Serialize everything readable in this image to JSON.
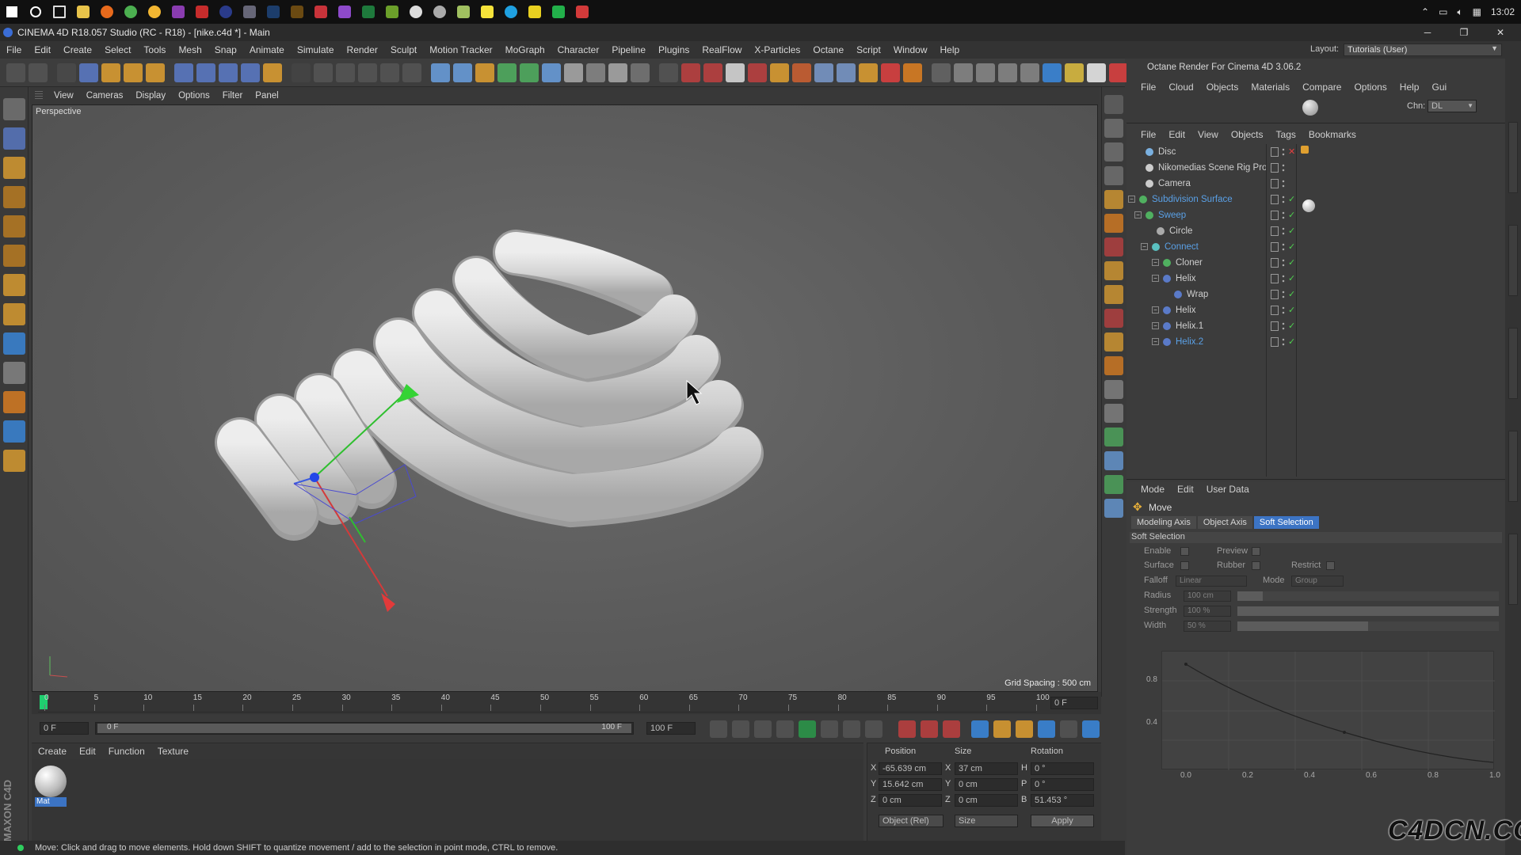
{
  "taskbar": {
    "time": "13:02"
  },
  "window": {
    "title": "CINEMA 4D R18.057 Studio (RC - R18) - [nike.c4d *] - Main"
  },
  "menubar": {
    "items": [
      "File",
      "Edit",
      "Create",
      "Select",
      "Tools",
      "Mesh",
      "Snap",
      "Animate",
      "Simulate",
      "Render",
      "Sculpt",
      "Motion Tracker",
      "MoGraph",
      "Character",
      "Pipeline",
      "Plugins",
      "RealFlow",
      "X-Particles",
      "Octane",
      "Script",
      "Window",
      "Help"
    ]
  },
  "layout": {
    "label": "Layout:",
    "value": "Tutorials (User)"
  },
  "viewport": {
    "menu": [
      "View",
      "Cameras",
      "Display",
      "Options",
      "Filter",
      "Panel"
    ],
    "camera_label": "Perspective",
    "grid_spacing": "Grid Spacing : 500 cm"
  },
  "timeline": {
    "ticks": [
      "0",
      "5",
      "10",
      "15",
      "20",
      "25",
      "30",
      "35",
      "40",
      "45",
      "50",
      "55",
      "60",
      "65",
      "70",
      "75",
      "80",
      "85",
      "90",
      "95",
      "100"
    ],
    "current_frame": "0 F",
    "start_field": "0 F",
    "range_start": "0 F",
    "range_end": "100 F",
    "end_field": "100 F"
  },
  "material_panel": {
    "menu": [
      "Create",
      "Edit",
      "Function",
      "Texture"
    ],
    "material_name": "Mat"
  },
  "coords": {
    "headers": {
      "position": "Position",
      "size": "Size",
      "rotation": "Rotation"
    },
    "rows": [
      {
        "axis": "X",
        "pos": "-65.639 cm",
        "size_axis": "X",
        "size": "37 cm",
        "rot_axis": "H",
        "rot": "0 °"
      },
      {
        "axis": "Y",
        "pos": "15.642 cm",
        "size_axis": "Y",
        "size": "0 cm",
        "rot_axis": "P",
        "rot": "0 °"
      },
      {
        "axis": "Z",
        "pos": "0 cm",
        "size_axis": "Z",
        "size": "0 cm",
        "rot_axis": "B",
        "rot": "51.453 °"
      }
    ],
    "mode_select": "Object (Rel)",
    "size_select": "Size",
    "apply": "Apply"
  },
  "status": {
    "message": "Move: Click and drag to move elements. Hold down SHIFT to quantize movement / add to the selection in point mode, CTRL to remove."
  },
  "octane": {
    "title": "Octane Render For Cinema 4D 3.06.2",
    "menu": [
      "File",
      "Cloud",
      "Objects",
      "Materials",
      "Compare",
      "Options",
      "Help",
      "Gui"
    ],
    "chn_label": "Chn:",
    "chn_value": "DL"
  },
  "objects": {
    "menu": [
      "File",
      "Edit",
      "View",
      "Objects",
      "Tags",
      "Bookmarks"
    ],
    "items": [
      {
        "name": "Disc",
        "color": "#cfcfcf"
      },
      {
        "name": "Nikomedias Scene Rig Pro",
        "color": "#cfcfcf"
      },
      {
        "name": "Camera",
        "color": "#cfcfcf"
      },
      {
        "name": "Subdivision Surface",
        "color": "#5aa0e6"
      },
      {
        "name": "Sweep",
        "color": "#5aa0e6"
      },
      {
        "name": "Circle",
        "color": "#cfcfcf"
      },
      {
        "name": "Connect",
        "color": "#5aa0e6"
      },
      {
        "name": "Cloner",
        "color": "#cfcfcf"
      },
      {
        "name": "Helix",
        "color": "#cfcfcf"
      },
      {
        "name": "Wrap",
        "color": "#cfcfcf"
      },
      {
        "name": "Helix",
        "color": "#cfcfcf"
      },
      {
        "name": "Helix.1",
        "color": "#cfcfcf"
      },
      {
        "name": "Helix.2",
        "color": "#5aa0e6"
      }
    ]
  },
  "attributes": {
    "menu": [
      "Mode",
      "Edit",
      "User Data"
    ],
    "tool": "Move",
    "tabs": [
      "Modeling Axis",
      "Object Axis",
      "Soft Selection"
    ],
    "section": "Soft Selection",
    "enable": "Enable",
    "preview": "Preview",
    "surface": "Surface",
    "rubber": "Rubber",
    "restrict": "Restrict",
    "falloff": "Falloff",
    "falloff_value": "Linear",
    "mode": "Mode",
    "mode_value": "Group",
    "radius": "Radius",
    "radius_value": "100 cm",
    "strength": "Strength",
    "strength_value": "100 %",
    "width": "Width",
    "width_value": "50 %",
    "graph_y": [
      "0.8",
      "0.4"
    ],
    "graph_x": [
      "0.0",
      "0.2",
      "0.4",
      "0.6",
      "0.8",
      "1.0"
    ]
  },
  "watermark": "C4DCN.COM"
}
